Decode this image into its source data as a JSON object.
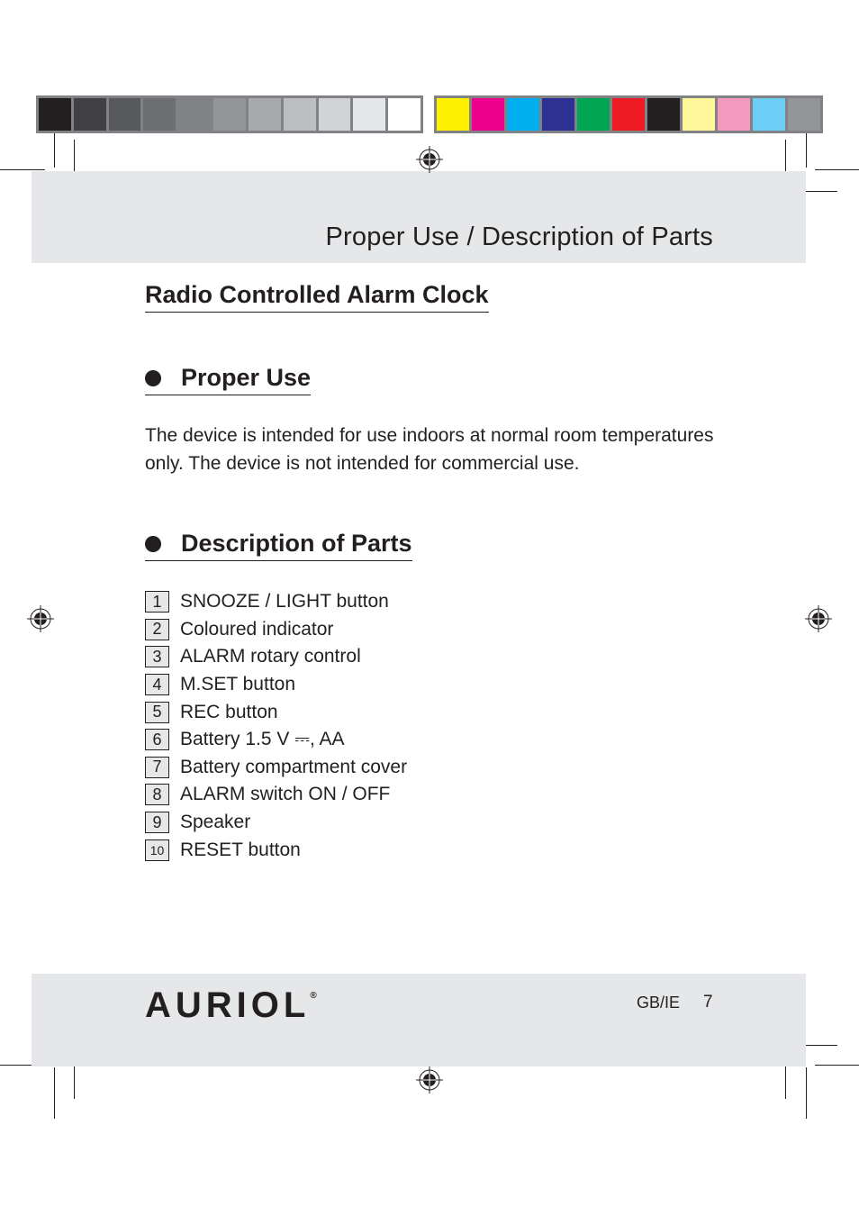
{
  "color_bars": {
    "grayscale": [
      "#231f20",
      "#414042",
      "#58595b",
      "#6d6e71",
      "#808285",
      "#939598",
      "#a7a9ac",
      "#bcbec0",
      "#d1d3d4",
      "#e6e7e8",
      "#ffffff"
    ],
    "process": [
      "#fff200",
      "#ec008c",
      "#00aeef",
      "#2e3192",
      "#00a651",
      "#ed1c24",
      "#231f20",
      "#fff799",
      "#f49ac1",
      "#6dcff6",
      "#939598"
    ]
  },
  "header": {
    "title": "Proper Use / Description of Parts"
  },
  "main": {
    "product_heading": "Radio Controlled Alarm Clock",
    "proper_use": {
      "heading": "Proper Use",
      "text": "The device is intended for use indoors at normal room temperatures only. The device is not intended for commercial use."
    },
    "description": {
      "heading": "Description of Parts",
      "parts": [
        {
          "num": "1",
          "label": "SNOOZE / LIGHT button"
        },
        {
          "num": "2",
          "label": "Coloured indicator"
        },
        {
          "num": "3",
          "label": "ALARM rotary control"
        },
        {
          "num": "4",
          "label": "M.SET button"
        },
        {
          "num": "5",
          "label": "REC button"
        },
        {
          "num": "6",
          "label": "Battery 1.5 V ⎓, AA"
        },
        {
          "num": "7",
          "label": "Battery compartment cover"
        },
        {
          "num": "8",
          "label": "ALARM switch ON / OFF"
        },
        {
          "num": "9",
          "label": "Speaker"
        },
        {
          "num": "10",
          "label": "RESET button"
        }
      ]
    }
  },
  "footer": {
    "brand": "AURIOL",
    "registered": "®",
    "locale": "GB/IE",
    "page_number": "7"
  }
}
